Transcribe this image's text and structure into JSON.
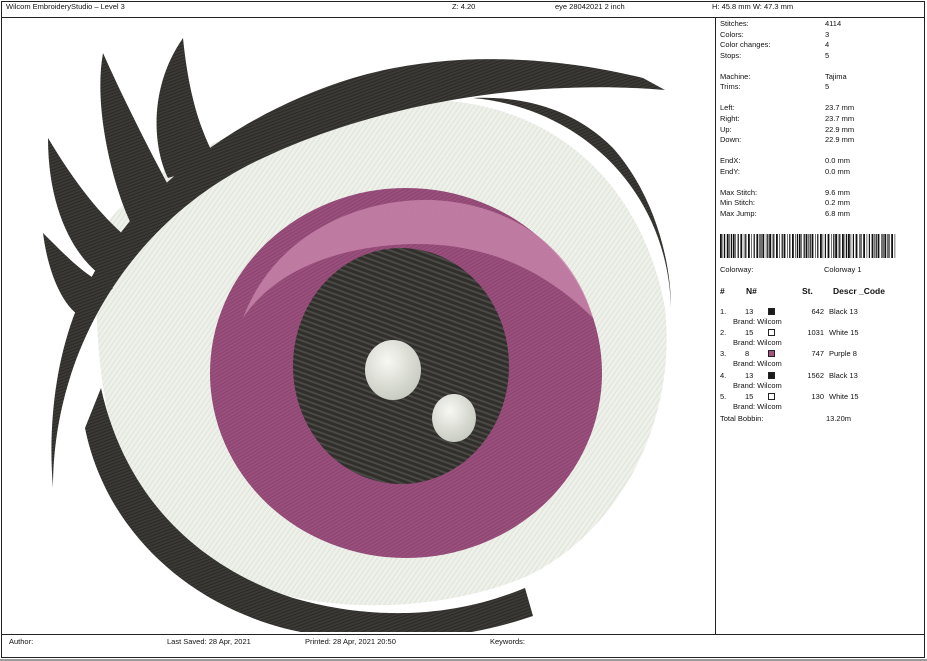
{
  "header": {
    "app_title": "Wilcom EmbroideryStudio – Level 3",
    "zoom": "Z: 4.20",
    "file": "eye 28042021 2 inch",
    "size": "H: 45.8 mm   W: 47.3 mm"
  },
  "stats": [
    {
      "label": "Stitches:",
      "value": "4114"
    },
    {
      "label": "Colors:",
      "value": "3"
    },
    {
      "label": "Color changes:",
      "value": "4"
    },
    {
      "label": "Stops:",
      "value": "5"
    },
    {
      "label": "Machine:",
      "value": "Tajima"
    },
    {
      "label": "Trims:",
      "value": "5"
    },
    {
      "label": "Left:",
      "value": "23.7 mm"
    },
    {
      "label": "Right:",
      "value": "23.7 mm"
    },
    {
      "label": "Up:",
      "value": "22.9 mm"
    },
    {
      "label": "Down:",
      "value": "22.9 mm"
    },
    {
      "label": "EndX:",
      "value": "0.0 mm"
    },
    {
      "label": "EndY:",
      "value": "0.0 mm"
    },
    {
      "label": "Max Stitch:",
      "value": "9.6 mm"
    },
    {
      "label": "Min Stitch:",
      "value": "0.2 mm"
    },
    {
      "label": "Max Jump:",
      "value": "6.8 mm"
    }
  ],
  "colorway": {
    "label": "Colorway:",
    "value": "Colorway 1"
  },
  "table": {
    "headers": {
      "num": "#",
      "needle": "N#",
      "stitches": "St.",
      "descr": "Descr _Code"
    },
    "rows": [
      {
        "index": "1.",
        "needle": "13",
        "color": "#1a1a1a",
        "stitches": "642",
        "descr": "Black 13",
        "brand": "Brand: Wilcom"
      },
      {
        "index": "2.",
        "needle": "15",
        "color": "#ffffff",
        "stitches": "1031",
        "descr": "White 15",
        "brand": "Brand: Wilcom"
      },
      {
        "index": "3.",
        "needle": "8",
        "color": "#a2537f",
        "stitches": "747",
        "descr": "Purple 8",
        "brand": "Brand: Wilcom"
      },
      {
        "index": "4.",
        "needle": "13",
        "color": "#1a1a1a",
        "stitches": "1562",
        "descr": "Black 13",
        "brand": "Brand: Wilcom"
      },
      {
        "index": "5.",
        "needle": "15",
        "color": "#ffffff",
        "stitches": "130",
        "descr": "White 15",
        "brand": "Brand: Wilcom"
      }
    ],
    "total_label": "Total Bobbin:",
    "total_value": "13.20m"
  },
  "footer": {
    "author": "Author:",
    "last_saved": "Last Saved: 28 Apr, 2021",
    "printed": "Printed: 28 Apr, 2021 20:50",
    "keywords": "Keywords:"
  },
  "design_colors": {
    "lash": "#3b3a36",
    "white": "#eef0ea",
    "iris": "#9a4f7c",
    "iris_light": "#c583a8",
    "pupil": "#302f2c",
    "highlight": "#e6e8e0"
  }
}
